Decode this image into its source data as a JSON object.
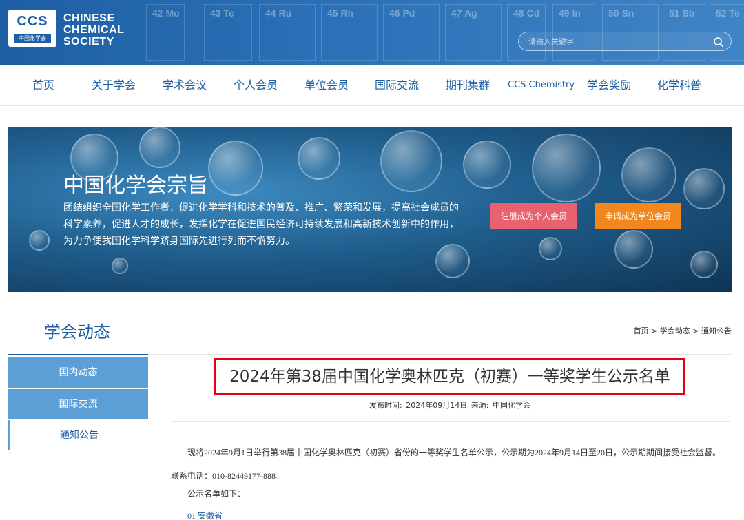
{
  "header": {
    "logo_abbr": "CCS",
    "logo_cn": "中国化学会",
    "logo_line1": "CHINESE",
    "logo_line2": "CHEMICAL",
    "logo_line3": "SOCIETY",
    "periodic_symbols": [
      "42 Mo",
      "43 Tc",
      "44 Ru",
      "45 Rh",
      "46 Pd",
      "47 Ag",
      "48 Cd",
      "49 In",
      "50 Sn",
      "51 Sb",
      "52 Te"
    ],
    "search_placeholder": "请输入关键字",
    "search_icon": "search-icon"
  },
  "nav": {
    "items": [
      "首页",
      "关于学会",
      "学术会议",
      "个人会员",
      "单位会员",
      "国际交流",
      "期刊集群",
      "CCS Chemistry",
      "学会奖励",
      "化学科普"
    ]
  },
  "banner": {
    "title": "中国化学会宗旨",
    "line1": "团结组织全国化学工作者，促进化学学科和技术的普及、推广、繁荣和发展，提高社会成员的",
    "line2": "科学素养，促进人才的成长，发挥化学在促进国民经济可持续发展和高新技术创新中的作用，",
    "line3": "为力争使我国化学科学跻身国际先进行列而不懈努力。",
    "btn_personal": "注册成为个人会员",
    "btn_unit": "申请成为单位会员"
  },
  "section": {
    "title": "学会动态",
    "breadcrumb": [
      "首页",
      "学会动态",
      "通知公告"
    ],
    "breadcrumb_sep": " > "
  },
  "sidebar": {
    "items": [
      "国内动态",
      "国际交流",
      "通知公告"
    ]
  },
  "article": {
    "title": "2024年第38届中国化学奥林匹克（初赛）一等奖学生公示名单",
    "meta_time_label": "发布时间:",
    "meta_time": "2024年09月14日",
    "meta_source_label": "来源:",
    "meta_source": "中国化学会",
    "paragraph": "现将2024年9月1日举行第38届中国化学奥林匹克（初赛）省份的一等奖学生名单公示，公示期为2024年9月14日至20日，公示期期间接受社会监督。联系电话：010-82449177-888。",
    "list_intro": "公示名单如下：",
    "first_item": "01 安徽省"
  },
  "colors": {
    "primary": "#1d5fa3",
    "sidebar_blue": "#5b9fd6",
    "btn_personal": "#e8616f",
    "btn_unit": "#f2881d",
    "highlight_border": "#e60012"
  }
}
